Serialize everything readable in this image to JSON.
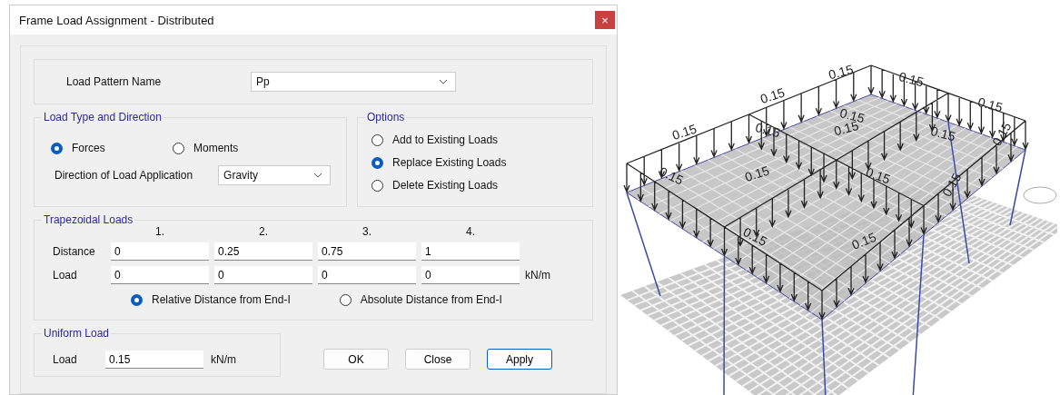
{
  "window": {
    "title": "Frame Load Assignment - Distributed",
    "close": "×"
  },
  "load_pattern": {
    "label": "Load Pattern Name",
    "value": "Pp"
  },
  "load_type": {
    "title": "Load Type and Direction",
    "choices": [
      {
        "label": "Forces",
        "selected": true
      },
      {
        "label": "Moments",
        "selected": false
      }
    ],
    "direction_label": "Direction of Load Application",
    "direction_value": "Gravity"
  },
  "options": {
    "title": "Options",
    "items": [
      {
        "label": "Add to Existing Loads",
        "selected": false
      },
      {
        "label": "Replace Existing Loads",
        "selected": true
      },
      {
        "label": "Delete Existing Loads",
        "selected": false
      }
    ]
  },
  "trapezoidal": {
    "title": "Trapezoidal Loads",
    "columns": [
      "1.",
      "2.",
      "3.",
      "4."
    ],
    "rows": [
      {
        "label": "Distance",
        "values": [
          "0",
          "0.25",
          "0.75",
          "1"
        ]
      },
      {
        "label": "Load",
        "values": [
          "0",
          "0",
          "0",
          "0"
        ],
        "unit": "kN/m"
      }
    ],
    "distance_modes": [
      {
        "label": "Relative Distance from End-I",
        "selected": true
      },
      {
        "label": "Absolute Distance from End-I",
        "selected": false
      }
    ]
  },
  "uniform": {
    "title": "Uniform Load",
    "label": "Load",
    "value": "0.15",
    "unit": "kN/m"
  },
  "buttons": [
    {
      "label": "OK",
      "focused": false
    },
    {
      "label": "Close",
      "focused": false
    },
    {
      "label": "Apply",
      "focused": true
    }
  ],
  "model_view": {
    "load_labels": [
      "0.15",
      "0.15",
      "0.15",
      "0.15",
      "0.15",
      "0.15",
      "0.15",
      "0.15",
      "0.15",
      "0.15",
      "0.15",
      "0.15",
      "0.15",
      "0.15",
      "0.15",
      "0.15"
    ]
  }
}
